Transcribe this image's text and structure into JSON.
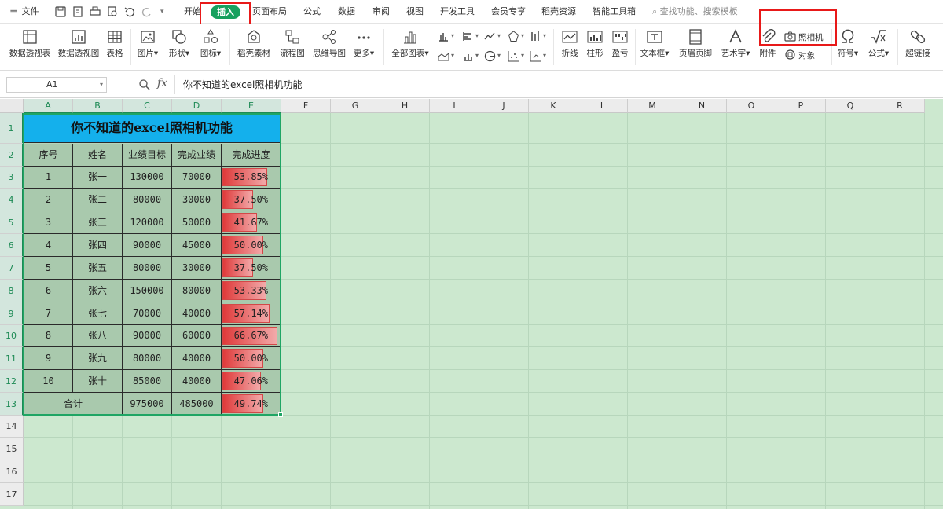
{
  "menubar": {
    "file": "文件",
    "tabs": [
      "开始",
      "插入",
      "页面布局",
      "公式",
      "数据",
      "审阅",
      "视图",
      "开发工具",
      "会员专享",
      "稻壳资源",
      "智能工具箱"
    ],
    "search_placeholder": "查找功能、搜索模板",
    "active_tab": "插入"
  },
  "ribbon": {
    "pivot_table": "数据透视表",
    "pivot_chart": "数据透视图",
    "table": "表格",
    "picture": "图片",
    "shapes": "形状",
    "icons": "图标",
    "docer_material": "稻壳素材",
    "flowchart": "流程图",
    "mindmap": "思维导图",
    "more": "更多",
    "all_charts": "全部图表",
    "sparkline_line": "折线",
    "sparkline_column": "柱形",
    "sparkline_winloss": "盈亏",
    "textbox": "文本框",
    "header_footer": "页眉页脚",
    "wordart": "艺术字",
    "attachment": "附件",
    "camera": "照相机",
    "object": "对象",
    "symbol": "符号",
    "formula": "公式",
    "hyperlink": "超链接"
  },
  "formula_bar": {
    "name_box": "A1",
    "fx": "fx",
    "content": "你不知道的excel照相机功能"
  },
  "sheet": {
    "columns": [
      "A",
      "B",
      "C",
      "D",
      "E",
      "F",
      "G",
      "H",
      "I",
      "J",
      "K",
      "L",
      "M",
      "N",
      "O",
      "P",
      "Q",
      "R"
    ],
    "rows": [
      "1",
      "2",
      "3",
      "4",
      "5",
      "6",
      "7",
      "8",
      "9",
      "10",
      "11",
      "12",
      "13",
      "14",
      "15",
      "16",
      "17"
    ],
    "selected_columns": [
      "A",
      "B",
      "C",
      "D",
      "E"
    ],
    "table": {
      "title": "你不知道的excel照相机功能",
      "headers": [
        "序号",
        "姓名",
        "业绩目标",
        "完成业绩",
        "完成进度"
      ],
      "rows": [
        {
          "no": "1",
          "name": "张一",
          "target": "130000",
          "done": "70000",
          "progress": "53.85%",
          "pct": 0.5385
        },
        {
          "no": "2",
          "name": "张二",
          "target": "80000",
          "done": "30000",
          "progress": "37.50%",
          "pct": 0.375
        },
        {
          "no": "3",
          "name": "张三",
          "target": "120000",
          "done": "50000",
          "progress": "41.67%",
          "pct": 0.4167
        },
        {
          "no": "4",
          "name": "张四",
          "target": "90000",
          "done": "45000",
          "progress": "50.00%",
          "pct": 0.5
        },
        {
          "no": "5",
          "name": "张五",
          "target": "80000",
          "done": "30000",
          "progress": "37.50%",
          "pct": 0.375
        },
        {
          "no": "6",
          "name": "张六",
          "target": "150000",
          "done": "80000",
          "progress": "53.33%",
          "pct": 0.5333
        },
        {
          "no": "7",
          "name": "张七",
          "target": "70000",
          "done": "40000",
          "progress": "57.14%",
          "pct": 0.5714
        },
        {
          "no": "8",
          "name": "张八",
          "target": "90000",
          "done": "60000",
          "progress": "66.67%",
          "pct": 0.6667
        },
        {
          "no": "9",
          "name": "张九",
          "target": "80000",
          "done": "40000",
          "progress": "50.00%",
          "pct": 0.5
        },
        {
          "no": "10",
          "name": "张十",
          "target": "85000",
          "done": "40000",
          "progress": "47.06%",
          "pct": 0.4706
        }
      ],
      "total": {
        "label": "合计",
        "target": "975000",
        "done": "485000",
        "progress": "49.74%",
        "pct": 0.4974
      }
    }
  },
  "colors": {
    "accent_green": "#17a05e",
    "highlight_red": "#e81919",
    "title_fill": "#14b0ec",
    "cell_fill": "#a9c9ad",
    "sheet_bg": "#cce8cf",
    "bar_red": "#df3a3a"
  }
}
